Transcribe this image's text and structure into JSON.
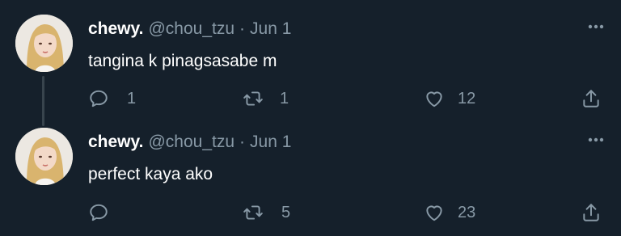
{
  "tweets": [
    {
      "name": "chewy.",
      "handle": "@chou_tzu",
      "separator": "·",
      "date": "Jun 1",
      "text": "tangina k pinagsasabe m",
      "reply_count": "1",
      "retweet_count": "1",
      "like_count": "12"
    },
    {
      "name": "chewy.",
      "handle": "@chou_tzu",
      "separator": "·",
      "date": "Jun 1",
      "text": "perfect kaya ako",
      "reply_count": "",
      "retweet_count": "5",
      "like_count": "23"
    }
  ],
  "icons": {
    "reply": "reply-icon",
    "retweet": "retweet-icon",
    "like": "heart-icon",
    "share": "share-icon",
    "more": "more-options-icon"
  },
  "colors": {
    "background": "#15202b",
    "secondary_text": "#8899a6",
    "primary_text": "#ffffff",
    "thread_line": "#38444d"
  }
}
